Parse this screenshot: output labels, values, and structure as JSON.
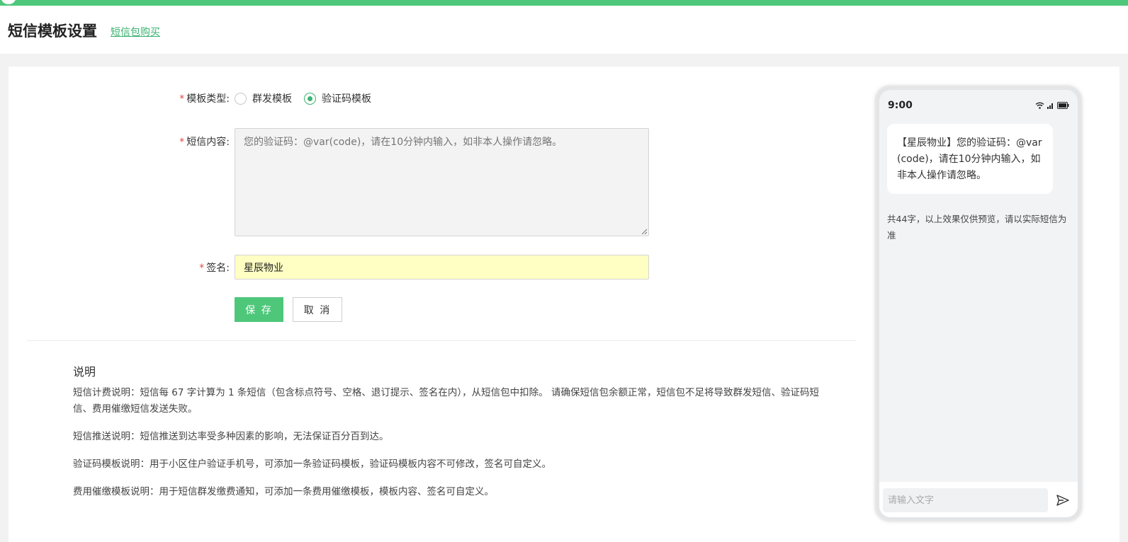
{
  "header": {
    "title": "短信模板设置",
    "buy_link": "短信包购买"
  },
  "form": {
    "template_type": {
      "label": "模板类型:",
      "options": [
        {
          "label": "群发模板",
          "checked": false
        },
        {
          "label": "验证码模板",
          "checked": true
        }
      ]
    },
    "sms_content": {
      "label": "短信内容:",
      "placeholder": "您的验证码：@var(code)，请在10分钟内输入，如非本人操作请忽略。",
      "value": ""
    },
    "signature": {
      "label": "签名:",
      "value": "星辰物业"
    },
    "save_label": "保 存",
    "cancel_label": "取 消"
  },
  "notes": {
    "title": "说明",
    "items": [
      "短信计费说明：短信每 67 字计算为 1 条短信（包含标点符号、空格、退订提示、签名在内），从短信包中扣除。 请确保短信包余额正常，短信包不足将导致群发短信、验证码短信、费用催缴短信发送失败。",
      "短信推送说明：短信推送到达率受多种因素的影响，无法保证百分百到达。",
      "验证码模板说明：用于小区住户验证手机号，可添加一条验证码模板，验证码模板内容不可修改，签名可自定义。",
      "费用催缴模板说明：用于短信群发缴费通知，可添加一条费用催缴模板，模板内容、签名可自定义。"
    ]
  },
  "phone": {
    "time": "9:00",
    "message": "【星辰物业】您的验证码：@var(code)，请在10分钟内输入，如非本人操作请忽略。",
    "count_note": "共44字，以上效果仅供预览，请以实际短信为准",
    "input_placeholder": "请输入文字"
  },
  "colors": {
    "accent": "#4ec77a",
    "required": "#e64545",
    "signature_bg": "#ffffc3"
  }
}
